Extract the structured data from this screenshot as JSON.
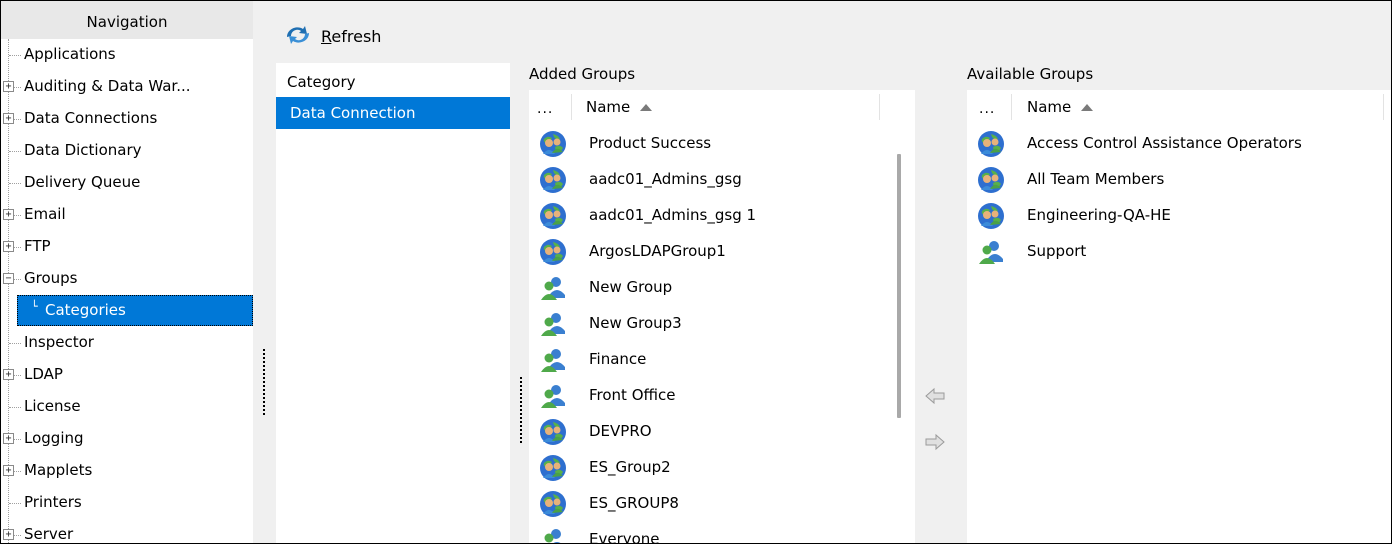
{
  "navigation": {
    "title": "Navigation",
    "items": [
      {
        "label": "Applications",
        "expander": ""
      },
      {
        "label": "Auditing & Data War...",
        "expander": "+"
      },
      {
        "label": "Data Connections",
        "expander": "+"
      },
      {
        "label": "Data Dictionary",
        "expander": ""
      },
      {
        "label": "Delivery Queue",
        "expander": ""
      },
      {
        "label": "Email",
        "expander": "+"
      },
      {
        "label": "FTP",
        "expander": "+"
      },
      {
        "label": "Groups",
        "expander": "−"
      },
      {
        "label": "Categories",
        "expander": ""
      },
      {
        "label": "Inspector",
        "expander": ""
      },
      {
        "label": "LDAP",
        "expander": "+"
      },
      {
        "label": "License",
        "expander": ""
      },
      {
        "label": "Logging",
        "expander": "+"
      },
      {
        "label": "Mapplets",
        "expander": "+"
      },
      {
        "label": "Printers",
        "expander": ""
      },
      {
        "label": "Server",
        "expander": "+"
      }
    ],
    "selected": "Categories"
  },
  "toolbar": {
    "refresh_mnemonic": "R",
    "refresh_rest": "efresh",
    "refresh_icon": "refresh-icon"
  },
  "category": {
    "header": "Category",
    "items": [
      "Data Connection"
    ],
    "selected": "Data Connection"
  },
  "added_groups": {
    "title": "Added Groups",
    "col_more": "...",
    "col_name": "Name",
    "rows": [
      {
        "name": "Product Success",
        "icon": "ldap-group-icon"
      },
      {
        "name": "aadc01_Admins_gsg",
        "icon": "ldap-group-icon"
      },
      {
        "name": "aadc01_Admins_gsg 1",
        "icon": "ldap-group-icon"
      },
      {
        "name": "ArgosLDAPGroup1",
        "icon": "ldap-group-icon"
      },
      {
        "name": "New Group",
        "icon": "local-group-icon"
      },
      {
        "name": "New Group3",
        "icon": "local-group-icon"
      },
      {
        "name": "Finance",
        "icon": "local-group-icon"
      },
      {
        "name": "Front Office",
        "icon": "local-group-icon"
      },
      {
        "name": "DEVPRO",
        "icon": "ldap-group-icon"
      },
      {
        "name": "ES_Group2",
        "icon": "ldap-group-icon"
      },
      {
        "name": "ES_GROUP8",
        "icon": "ldap-group-icon"
      },
      {
        "name": "Everyone",
        "icon": "local-group-icon"
      }
    ]
  },
  "available_groups": {
    "title": "Available Groups",
    "col_more": "...",
    "col_name": "Name",
    "rows": [
      {
        "name": "Access Control Assistance Operators",
        "icon": "ldap-group-icon"
      },
      {
        "name": "All Team Members",
        "icon": "ldap-group-icon"
      },
      {
        "name": "Engineering-QA-HE",
        "icon": "ldap-group-icon"
      },
      {
        "name": "Support",
        "icon": "local-group-icon"
      }
    ]
  },
  "move_buttons": {
    "left_icon": "arrow-left-icon",
    "right_icon": "arrow-right-icon"
  },
  "colors": {
    "selection": "#0078d7",
    "background": "#f0f0f0"
  }
}
